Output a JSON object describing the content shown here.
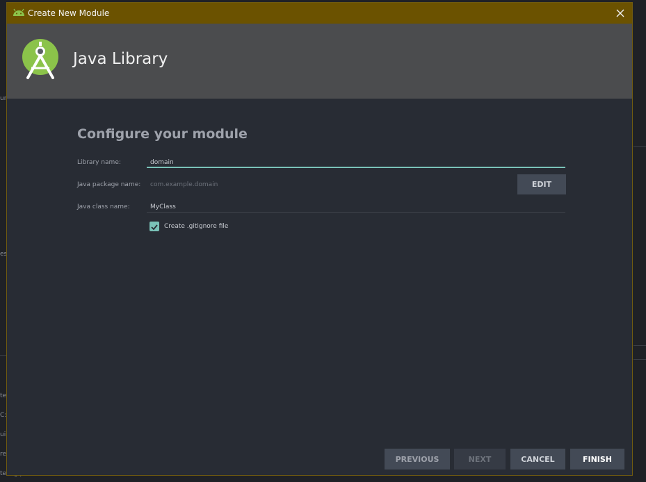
{
  "window": {
    "title": "Create New Module"
  },
  "header": {
    "heading": "Java Library"
  },
  "form": {
    "section_title": "Configure your module",
    "library_name_label": "Library name:",
    "library_name_value": "domain",
    "package_name_label": "Java package name:",
    "package_name_value": "com.example.domain",
    "edit_label": "EDIT",
    "class_name_label": "Java class name:",
    "class_name_value": "MyClass",
    "gitignore_label": "Create .gitignore file",
    "gitignore_checked": true
  },
  "footer": {
    "previous_label": "PREVIOUS",
    "next_label": "NEXT",
    "cancel_label": "CANCEL",
    "finish_label": "FINISH"
  },
  "background_fragments": [
    "ure",
    "es",
    "te",
    "C:\\",
    "uil",
    "re",
    "te  alg  p"
  ],
  "colors": {
    "titlebar": "#6b5200",
    "header": "#4b4c4e",
    "dialog": "#282c34",
    "accent": "#7ac2b8",
    "android_green": "#8bc34a"
  },
  "icons": {
    "titlebar": "android-icon",
    "logo": "android-studio-logo",
    "close": "close-icon",
    "checkbox": "checkmark-icon"
  }
}
